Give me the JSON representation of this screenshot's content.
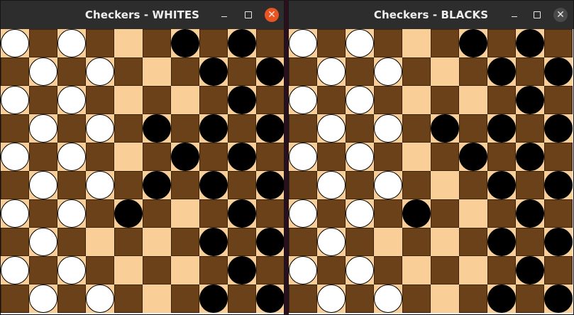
{
  "colors": {
    "light_square": "#f9cf97",
    "dark_square": "#6b4119",
    "white_piece": "#ffffff",
    "black_piece": "#000000",
    "titlebar": "#2d2d2d",
    "close_active": "#e95420",
    "close_inactive": "#4a4a4a"
  },
  "icons": {
    "minimize": "minimize-icon",
    "maximize": "maximize-icon",
    "close": "close-icon",
    "close_glyph": "✕"
  },
  "windows": [
    {
      "title": "Checkers - WHITES",
      "active": true,
      "board": [
        "W.W...B.B.",
        ".W.W...B.B",
        "W.W.....B.",
        ".W.W.B.B.B",
        "W.W...B.B.",
        ".W.W.B.B.B",
        "W.W.B...B.",
        ".W.....B.B",
        "W.W.....B.",
        ".W.W...B.B"
      ]
    },
    {
      "title": "Checkers - BLACKS",
      "active": false,
      "board": [
        "W.W...B.B.",
        ".W.W...B.B",
        "W.W.....B.",
        ".W.W.B.B.B",
        "W.W...B.B.",
        ".W.W...B.B",
        "W.W.B...B.",
        ".W.....B.B",
        "W.W.....B.",
        ".W.W...B.B"
      ]
    }
  ]
}
